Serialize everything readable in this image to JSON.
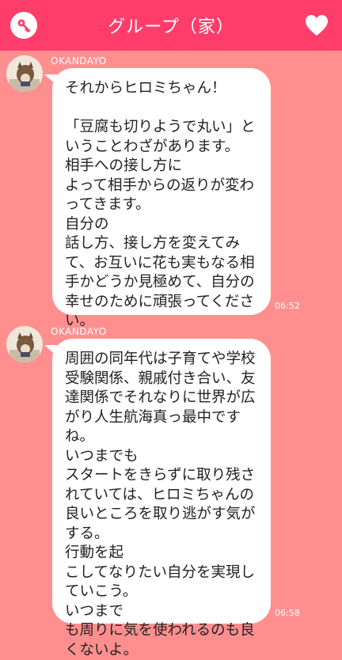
{
  "header": {
    "title": "グループ（家）",
    "left_icon": "key-icon",
    "right_icon": "heart-icon",
    "color": "#ff3d6b"
  },
  "background_color": "#ff8f8f",
  "messages": [
    {
      "sender": "OKANDAYO",
      "text": "それからヒロミちゃん！\n\n「豆腐も切りようで丸い」ということわざがあります。\n相手への接し方に\nよって相手からの返りが変わってきます。\n自分の\n話し方、接し方を変えてみて、お互いに花も実もなる相手かどうか見極めて、自分の幸せのために頑張ってください。",
      "time": "06:52"
    },
    {
      "sender": "OKANDAYO",
      "text": "周囲の同年代は子育てや学校受験関係、親戚付き合い、友達関係でそれなりに世界が広がり人生航海真っ最中ですね。\nいつまでも\nスタートをきらずに取り残されていては、ヒロミちゃんの良いところを取り逃がす気がする。\n行動を起\nこしてなりたい自分を実現していこう。\nいつまで\nも周りに気を使われるのも良くないよ。",
      "time": "06:58"
    }
  ]
}
